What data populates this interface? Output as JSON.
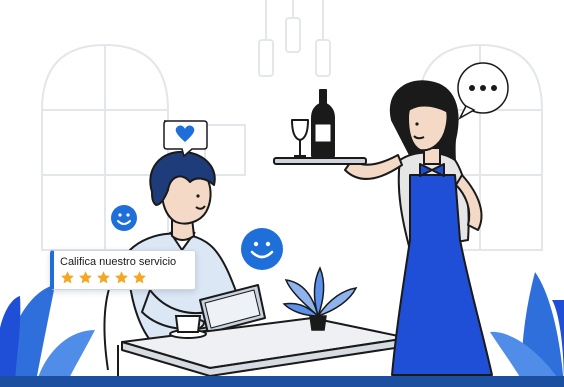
{
  "rating_card": {
    "label": "Califica nuestro servicio",
    "stars": 5,
    "accent_color": "#1e6fd9",
    "star_color": "#f5a623"
  },
  "speech_bubbles": [
    {
      "content": "heart-icon",
      "color": "#1e6fd9"
    },
    {
      "content": "ellipsis-icon",
      "color": "#1a1a1a"
    }
  ],
  "colors": {
    "brand_blue": "#1e4fd6",
    "leaf_blue": "#2f6fdb",
    "outline": "#1a1a1a",
    "bottom_bar": "#1d4fa0"
  }
}
